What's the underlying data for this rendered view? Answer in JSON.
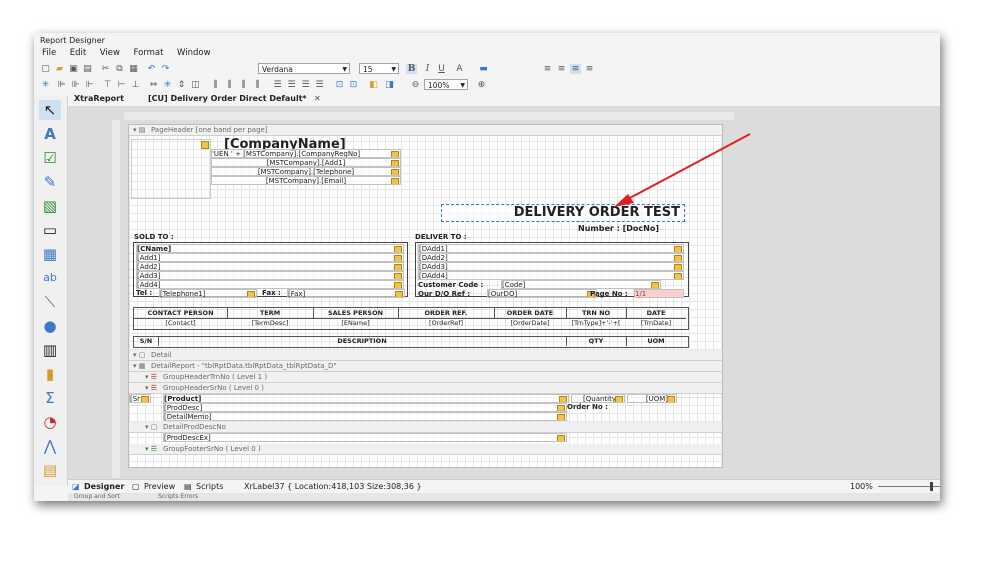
{
  "window": {
    "title": "Report Designer"
  },
  "menu": [
    "File",
    "Edit",
    "View",
    "Format",
    "Window"
  ],
  "toolbar": {
    "font": "Verdana",
    "font_size": "15",
    "zoom": "100%"
  },
  "tabs": {
    "home": "XtraReport",
    "document": "[CU] Delivery Order Direct Default*"
  },
  "bands": {
    "page_header": "PageHeader [one band per page]",
    "detail": "Detail",
    "detail_report": "DetailReport - \"tblRptData.tblRptData_tblRptData_D\"",
    "group_header_trn": "GroupHeaderTrnNo ( Level 1 )",
    "group_header_sr": "GroupHeaderSrNo ( Level 0 )",
    "detail_prod": "DetailProdDescNo",
    "group_footer_sr": "GroupFooterSrNo ( Level 0 )"
  },
  "report": {
    "company_name": "[CompanyName]",
    "uen": "'UEN ' + [MSTCompany].[CompanyRegNo]",
    "addr1": "[MSTCompany].[Add1]",
    "telephone": "[MSTCompany].[Telephone]",
    "email": "[MSTCompany].[Email]",
    "doc_title": "DELIVERY ORDER TEST",
    "number": "Number : [DocNo]",
    "sold_to": "SOLD TO :",
    "deliver_to": "DELIVER TO :",
    "sold_lines": [
      "[CName]",
      "[Add1]",
      "[Add2]",
      "[Add3]",
      "[Add4]"
    ],
    "tel_label": "Tel :",
    "tel_value": "[Telephone1]",
    "fax_label": "Fax :",
    "fax_value": "[Fax]",
    "deliver_lines": [
      "[DAdd1]",
      "[DAdd2]",
      "[DAdd3]",
      "[DAdd4]"
    ],
    "customer_code_label": "Customer Code :",
    "customer_code_value": "[Code]",
    "do_ref_label": "Our D/O Ref :",
    "do_ref_value": "[OurDO]",
    "page_no_label": "Page No :",
    "page_no_value": "1/1",
    "table_headers": [
      "CONTACT PERSON",
      "TERM",
      "SALES PERSON",
      "ORDER REF.",
      "ORDER DATE",
      "TRN NO",
      "DATE"
    ],
    "table_values": [
      "[Contact]",
      "[TermDesc]",
      "[EName]",
      "[OrderRef]",
      "[OrderDate]",
      "[TrnType]+'-'+[",
      "[TrnDate]"
    ],
    "item_headers": {
      "sn": "S/N",
      "desc": "DESCRIPTION",
      "qty": "QTY",
      "uom": "UOM"
    },
    "product": "[Product]",
    "sr": "[Sr",
    "prod_desc": "[ProdDesc]",
    "detail_memo": "[DetailMemo]",
    "quantity": "[Quantity",
    "uom": "[UOM]",
    "order_no": "Order No :",
    "prod_desc_ex": "[ProdDescEx]"
  },
  "status": {
    "designer": "Designer",
    "preview": "Preview",
    "scripts": "Scripts",
    "info": "XrLabel37 { Location:418,103 Size:308,36 }",
    "zoom": "100%"
  },
  "bottom": {
    "group_sort": "Group and Sort",
    "scripts_errors": "Scripts Errors"
  },
  "colors": {
    "arrow": "#e02020",
    "accent": "#3c78c8",
    "tag": "#f2c14e"
  }
}
